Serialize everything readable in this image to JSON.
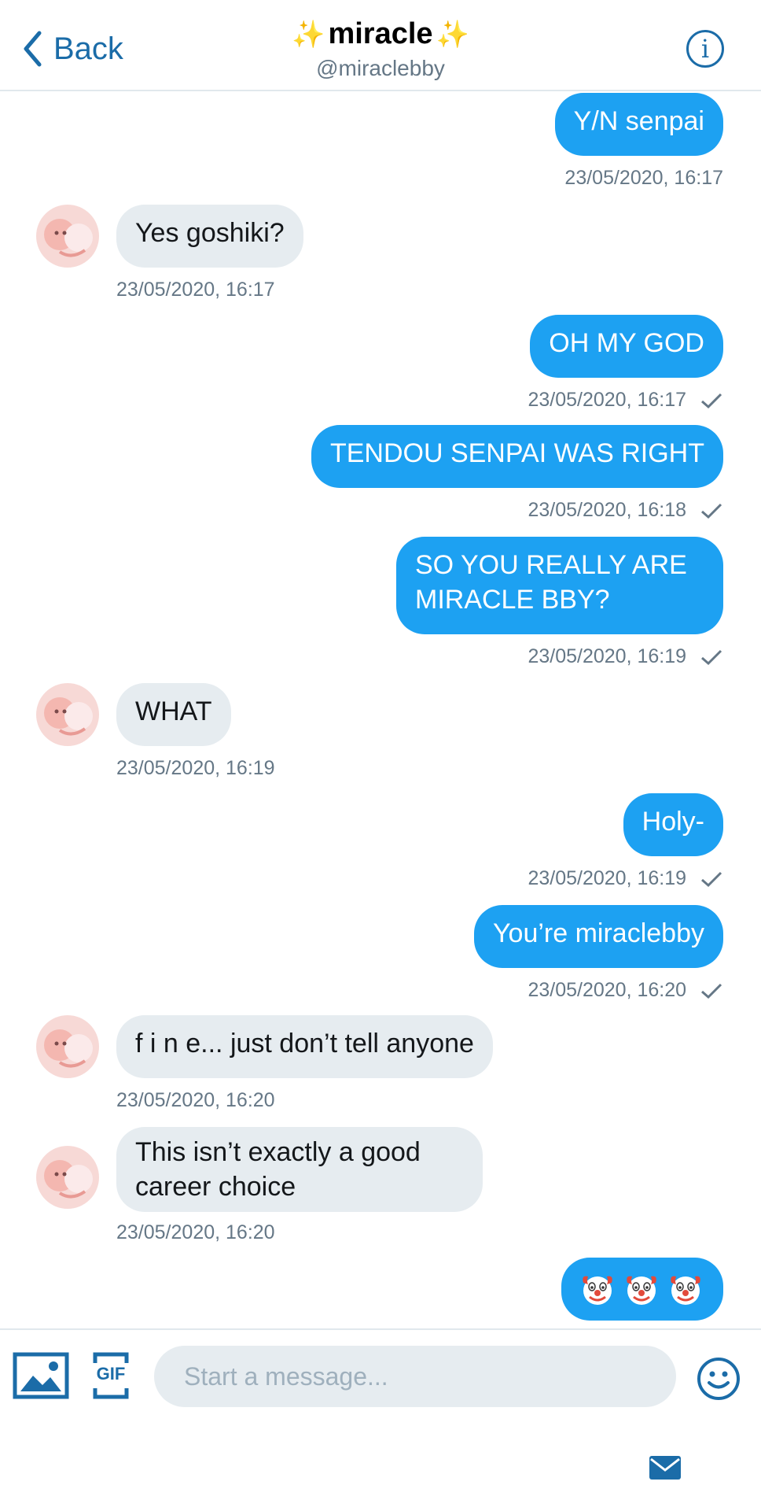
{
  "header": {
    "back_label": "Back",
    "title": "miracle",
    "title_emoji": "✨",
    "handle": "@miraclebby",
    "info_icon": "info-icon"
  },
  "messages": [
    {
      "direction": "out",
      "text": "Y/N senpai",
      "timestamp": "23/05/2020, 16:17",
      "read": false
    },
    {
      "direction": "in",
      "text": "Yes goshiki?",
      "timestamp": "23/05/2020, 16:17"
    },
    {
      "direction": "out",
      "text": "OH MY GOD",
      "timestamp": "23/05/2020, 16:17",
      "read": true
    },
    {
      "direction": "out",
      "text": "TENDOU SENPAI WAS RIGHT",
      "timestamp": "23/05/2020, 16:18",
      "read": true
    },
    {
      "direction": "out",
      "text_lines": [
        "SO YOU REALLY ARE",
        "MIRACLE BBY?"
      ],
      "timestamp": "23/05/2020, 16:19",
      "read": true
    },
    {
      "direction": "in",
      "text": "WHAT",
      "timestamp": "23/05/2020, 16:19"
    },
    {
      "direction": "out",
      "text": "Holy-",
      "timestamp": "23/05/2020, 16:19",
      "read": true
    },
    {
      "direction": "out",
      "text": "You’re miraclebby",
      "timestamp": "23/05/2020, 16:20",
      "read": true
    },
    {
      "direction": "in",
      "text": "f i n e... just don’t tell anyone",
      "timestamp": "23/05/2020, 16:20"
    },
    {
      "direction": "in",
      "text_lines": [
        "This isn’t exactly a good",
        "career choice"
      ],
      "timestamp": "23/05/2020, 16:20"
    },
    {
      "direction": "out",
      "text": "🤡🤡🤡",
      "emoji": "clown-face",
      "count": 3
    }
  ],
  "composer": {
    "placeholder": "Start a message...",
    "image_icon": "image-icon",
    "gif_label": "GIF",
    "emoji_icon": "emoji-icon"
  },
  "bottom_bar": {
    "icon": "mail-icon"
  },
  "colors": {
    "accent": "#1da1f2",
    "link": "#1b6ca8",
    "incoming_bubble": "#e6ecf0",
    "timestamp": "#657786"
  }
}
